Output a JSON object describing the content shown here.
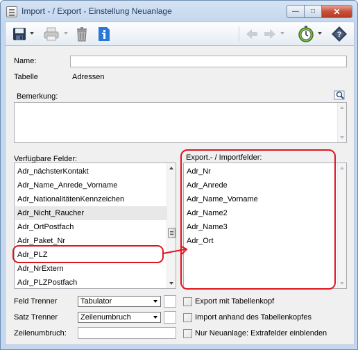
{
  "window": {
    "title": "Import - / Export - Einstellung Neuanlage",
    "min_glyph": "—",
    "max_glyph": "□",
    "close_glyph": "✕"
  },
  "toolbar": {
    "icons": [
      "save-icon",
      "print-icon",
      "delete-icon",
      "info-icon",
      "back-icon",
      "forward-icon",
      "timer-icon",
      "help-icon"
    ]
  },
  "form": {
    "name_label": "Name:",
    "name_value": "",
    "tabelle_label": "Tabelle",
    "tabelle_value": "Adressen",
    "bemerkung_label": "Bemerkung:",
    "bemerkung_value": "",
    "available_label": "Verfügbare Felder:",
    "export_label": "Export.- / Importfelder:"
  },
  "available_fields": [
    "Adr_nächsterKontakt",
    "Adr_Name_Anrede_Vorname",
    "Adr_NationalitätenKennzeichen",
    "Adr_Nicht_Raucher",
    "Adr_OrtPostfach",
    "Adr_Paket_Nr",
    "Adr_PLZ",
    "Adr_NrExtern",
    "Adr_PLZPostfach"
  ],
  "export_fields": [
    "Adr_Nr",
    "Adr_Anrede",
    "Adr_Name_Vorname",
    "Adr_Name2",
    "Adr_Name3",
    "Adr_Ort"
  ],
  "options": {
    "feld_trenner_label": "Feld Trenner",
    "feld_trenner_value": "Tabulator",
    "satz_trenner_label": "Satz Trenner",
    "satz_trenner_value": "Zeilenumbruch",
    "zeilenumbruch_label": "Zeilenumbruch:",
    "zeilenumbruch_value": "",
    "export_header_label": "Export mit Tabellenkopf",
    "import_header_label": "Import anhand des Tabellenkopfes",
    "extra_fields_label": "Nur Neuanlage: Extrafelder einblenden",
    "export_header_checked": false,
    "import_header_checked": false,
    "extra_fields_checked": false
  },
  "colors": {
    "annotation_red": "#e0141e",
    "title_text": "#1e395b"
  }
}
